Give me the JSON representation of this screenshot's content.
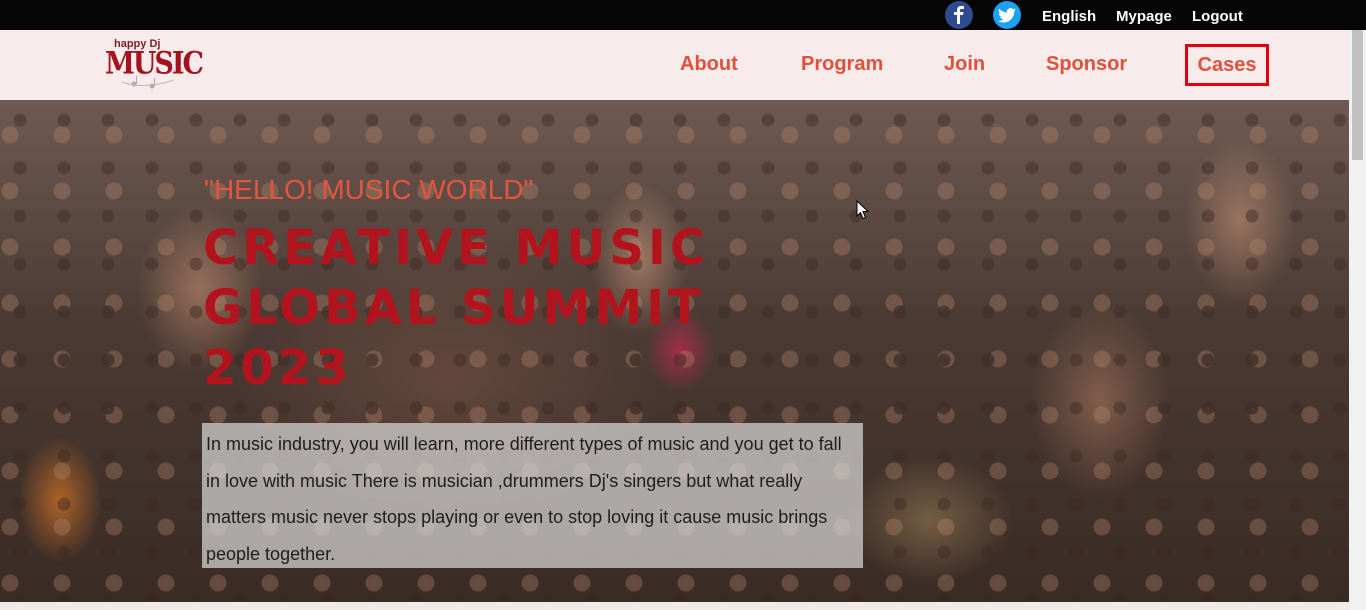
{
  "topbar": {
    "social": [
      {
        "icon": "facebook-icon",
        "glyph": "f",
        "color": "#2d4b8e"
      },
      {
        "icon": "twitter-icon",
        "color": "#1da1f2"
      }
    ],
    "language": "English",
    "mypage": "Mypage",
    "logout": "Logout"
  },
  "header": {
    "logo": {
      "small": "happy Dj",
      "big": "MUSIC"
    },
    "nav": [
      {
        "label": "About"
      },
      {
        "label": "Program"
      },
      {
        "label": "Join"
      },
      {
        "label": "Sponsor"
      },
      {
        "label": "Cases",
        "selected": true
      }
    ]
  },
  "hero": {
    "subtitle": "\"HELLO! MUSIC WORLD\"",
    "title": "CREATIVE MUSIC GLOBAL SUMMIT 2023",
    "description": "In music industry, you will learn, more different types of music and you get to fall in love with music There is musician ,drummers Dj's singers but what really matters music never stops playing or even to stop loving it cause music brings people together."
  },
  "colors": {
    "accent": "#e0503b",
    "title_red": "#b3131c",
    "highlight_border": "#e3000f",
    "topbar_bg": "#050505",
    "header_bg": "#f8ebeb"
  }
}
